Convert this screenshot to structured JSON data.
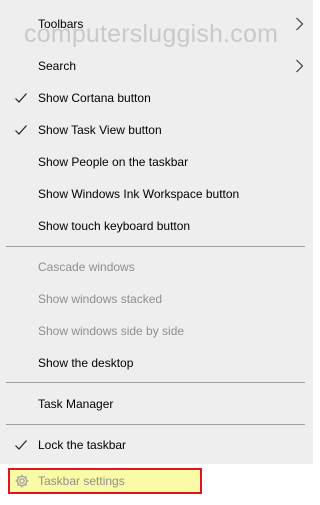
{
  "watermark": "computersluggish.com",
  "menu": {
    "toolbars": "Toolbars",
    "search": "Search",
    "show_cortana": "Show Cortana button",
    "show_task_view": "Show Task View button",
    "show_people": "Show People on the taskbar",
    "show_ink": "Show Windows Ink Workspace button",
    "show_touch_keyboard": "Show touch keyboard button",
    "cascade": "Cascade windows",
    "stacked": "Show windows stacked",
    "side_by_side": "Show windows side by side",
    "show_desktop": "Show the desktop",
    "task_manager": "Task Manager",
    "lock_taskbar": "Lock the taskbar",
    "taskbar_settings": "Taskbar settings"
  },
  "colors": {
    "menu_bg": "#eeeeee",
    "disabled_text": "#8e8e8e",
    "highlight_fill": "#fbfaa6",
    "highlight_border": "#e0141d"
  },
  "icons": {
    "check": "check-icon",
    "submenu": "chevron-right-icon",
    "settings": "gear-icon"
  }
}
